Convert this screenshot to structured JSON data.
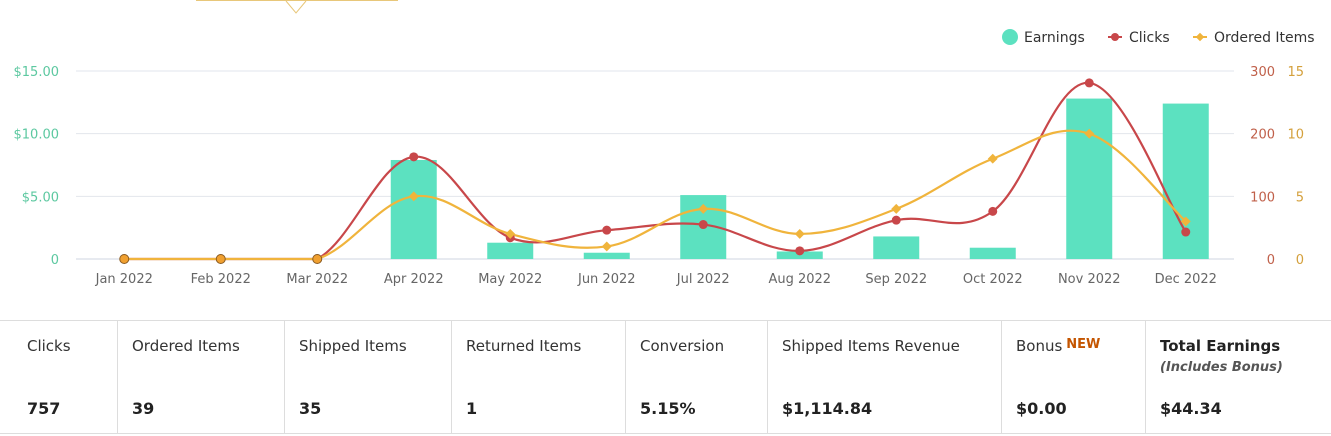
{
  "chart_data": {
    "type": "bar+line",
    "categories": [
      "Jan 2022",
      "Feb 2022",
      "Mar 2022",
      "Apr 2022",
      "May 2022",
      "Jun 2022",
      "Jul 2022",
      "Aug 2022",
      "Sep 2022",
      "Oct 2022",
      "Nov 2022",
      "Dec 2022"
    ],
    "series": [
      {
        "name": "Earnings",
        "kind": "bar",
        "axis": "left",
        "color": "#5ce1c0",
        "values": [
          0,
          0,
          0,
          7.9,
          1.3,
          0.5,
          5.1,
          0.6,
          1.8,
          0.9,
          12.8,
          12.4
        ]
      },
      {
        "name": "Clicks",
        "kind": "line",
        "axis": "right1",
        "color": "#c8474a",
        "values": [
          0,
          0,
          0,
          163,
          34,
          46,
          55,
          13,
          62,
          76,
          281,
          43
        ]
      },
      {
        "name": "Ordered Items",
        "kind": "line",
        "axis": "right2",
        "color": "#f0b43c",
        "values": [
          0,
          0,
          0,
          5,
          2,
          1,
          4,
          2,
          4,
          8,
          10,
          3
        ]
      }
    ],
    "left_axis": {
      "ticks": [
        "$15.00",
        "$10.00",
        "$5.00",
        "0"
      ],
      "range": [
        0,
        15
      ],
      "color": "#5cc8a0"
    },
    "right_axis_1": {
      "ticks": [
        "300",
        "200",
        "100",
        "0"
      ],
      "range": [
        0,
        300
      ],
      "color": "#c0604a"
    },
    "right_axis_2": {
      "ticks": [
        "15",
        "10",
        "5",
        "0"
      ],
      "range": [
        0,
        15
      ],
      "color": "#d4a03c"
    },
    "legend_position": "top-right",
    "grid": true
  },
  "stats": [
    {
      "label": "Clicks",
      "value": "757"
    },
    {
      "label": "Ordered Items",
      "value": "39"
    },
    {
      "label": "Shipped Items",
      "value": "35"
    },
    {
      "label": "Returned Items",
      "value": "1"
    },
    {
      "label": "Conversion",
      "value": "5.15%"
    },
    {
      "label": "Shipped Items Revenue",
      "value": "$1,114.84"
    },
    {
      "label": "Bonus",
      "badge": "NEW",
      "value": "$0.00"
    },
    {
      "label": "Total Earnings",
      "sublabel": "(Includes Bonus)",
      "value": "$44.34"
    }
  ]
}
